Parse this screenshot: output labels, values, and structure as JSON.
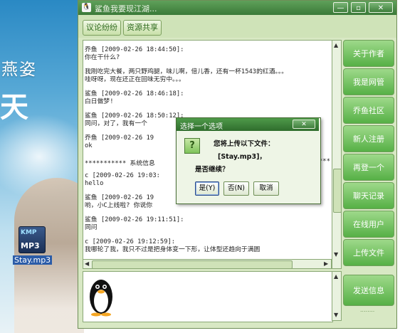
{
  "desktop": {
    "wallpaper_text_1": "燕姿",
    "wallpaper_text_2": "天",
    "file_icon_badge": "KMP",
    "file_icon_format": "MP3",
    "file_icon_label": "Stay.mp3"
  },
  "window": {
    "title": "鲨鱼我要现江湖...",
    "minimize": "—",
    "maximize": "▫",
    "close": "✕",
    "toolbar": {
      "discuss_label": "议论纷纷",
      "share_label": "资源共享"
    },
    "chat": [
      {
        "header": "乔鱼 [2009-02-26 18:44:50]:",
        "body": "你在干什么?"
      },
      {
        "header": "",
        "body": "我刚吃完大餐，两只野鸡腿，味儿啊，倍儿香，还有一杯1543的红酒。。。\n哇呀呀，现在还正在回味无穷中。。。"
      },
      {
        "header": "鲨鱼 [2009-02-26 18:46:18]:",
        "body": "白日做梦!"
      },
      {
        "header": "鲨鱼 [2009-02-26 18:50:12]:",
        "body": "同问，对了，我有一个"
      },
      {
        "header": "乔鱼 [2009-02-26 19",
        "body": "ok"
      },
      {
        "header": "",
        "body": "*********** 系统信息"
      },
      {
        "header": "c [2009-02-26 19:03:",
        "body": "hello"
      },
      {
        "header": "鲨鱼 [2009-02-26 19",
        "body": "哟，小C上线啦? 你说你"
      },
      {
        "header": "鲨鱼 [2009-02-26 19:11:51]:",
        "body": "同问"
      },
      {
        "header": "c [2009-02-26 19:12:59]:",
        "body": "我哪轮了我，我只不过是把身体变一下形，让体型还趋向于满圆"
      }
    ],
    "sys_tail": "***",
    "side_buttons": [
      "关于作者",
      "我是网管",
      "乔鱼社区",
      "新人注册",
      "再登一个",
      "聊天记录",
      "在线用户",
      "上传文件"
    ],
    "send_label": "发送信息",
    "send_dots": "........"
  },
  "dialog": {
    "title": "选择一个选项",
    "close": "✕",
    "icon": "?",
    "line1": "您将上传以下文件：",
    "line2": "[Stay.mp3]，",
    "line3": "是否继续？",
    "yes": "是(Y)",
    "no": "否(N)",
    "cancel": "取消"
  }
}
